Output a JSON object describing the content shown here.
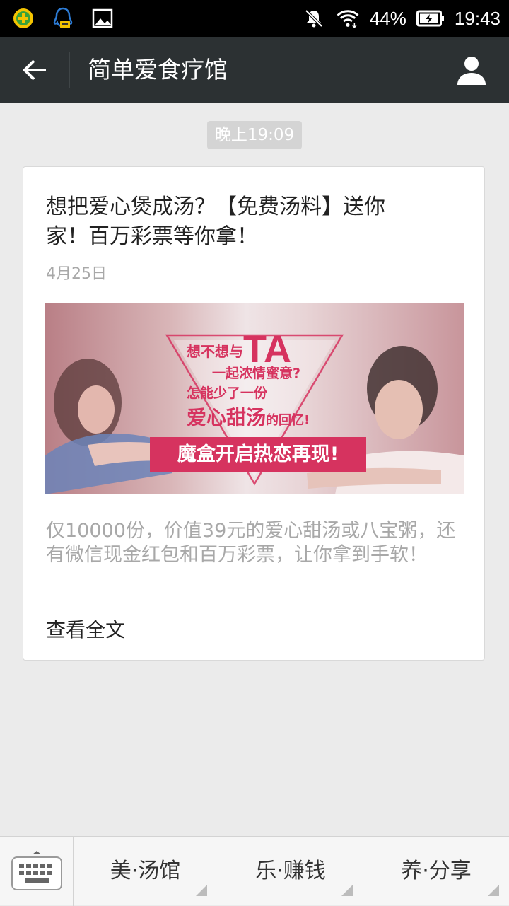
{
  "status_bar": {
    "battery": "44%",
    "time": "19:43",
    "icons": [
      "app-store-icon",
      "qq-icon",
      "image-icon",
      "mute-icon",
      "wifi-icon",
      "battery-icon"
    ]
  },
  "header": {
    "title": "简单爱食疗馆"
  },
  "chat": {
    "timestamp": "晚上19:09"
  },
  "article": {
    "title": "想把爱心煲成汤？【免费汤料】送你家！百万彩票等你拿！",
    "date": "4月25日",
    "banner": {
      "line1_prefix": "想不想与",
      "line1_big": "TA",
      "line2": "一起浓情蜜意?",
      "line3": "怎能少了一份",
      "line4_big": "爱心甜汤",
      "line4_suffix": "的回忆!",
      "cta": "魔盒开启热恋再现!"
    },
    "summary": "仅10000份，价值39元的爱心甜汤或八宝粥，还有微信现金红包和百万彩票，让你拿到手软！",
    "read_more": "查看全文"
  },
  "bottom_menu": {
    "items": [
      {
        "label": "美·汤馆"
      },
      {
        "label": "乐·赚钱"
      },
      {
        "label": "养·分享"
      }
    ]
  },
  "colors": {
    "title_bar": "#2c3133",
    "background": "#ebebeb",
    "banner_accent": "#d6335f"
  }
}
